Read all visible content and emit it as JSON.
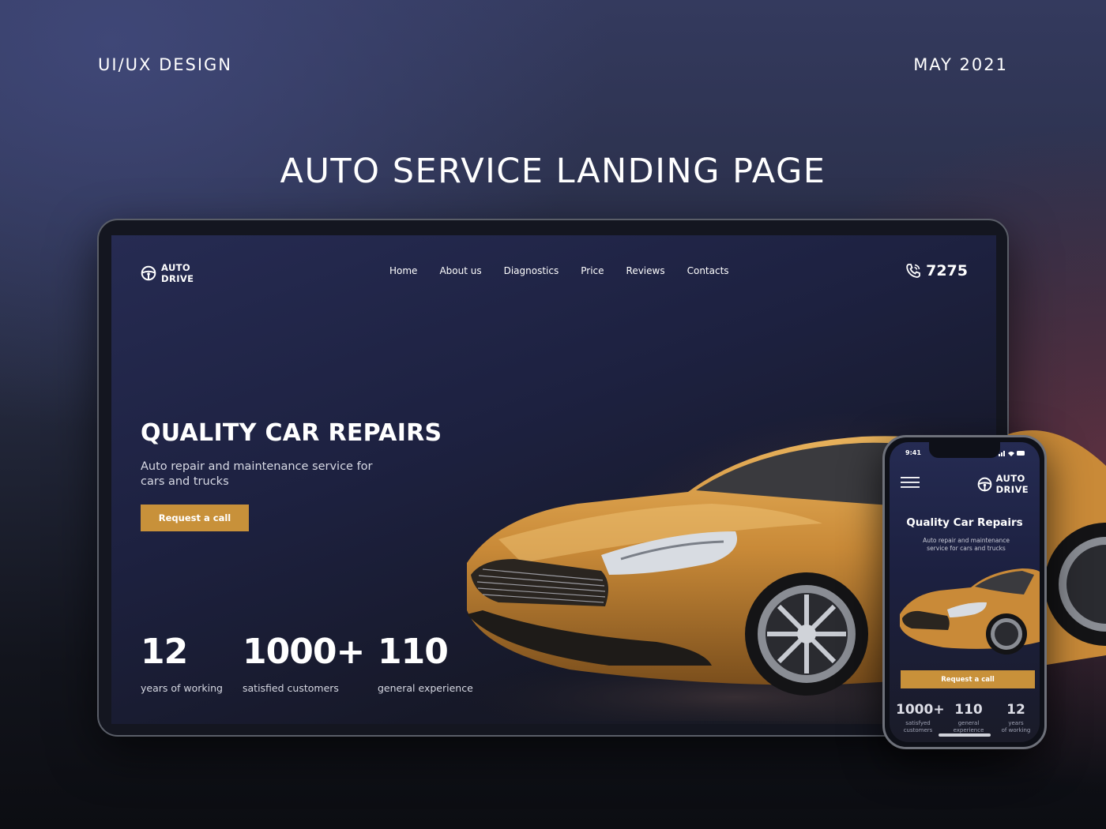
{
  "header": {
    "category": "UI/UX DESIGN",
    "date": "MAY 2021",
    "title": "AUTO SERVICE LANDING PAGE"
  },
  "site": {
    "logo": {
      "line1": "AUTO",
      "line2": "DRIVE",
      "icon": "steering-wheel-icon"
    },
    "nav": [
      "Home",
      "About us",
      "Diagnostics",
      "Price",
      "Reviews",
      "Contacts"
    ],
    "phone": "7275",
    "phone_icon": "phone-icon",
    "hero": {
      "title": "QUALITY CAR REPAIRS",
      "subtitle": "Auto repair and maintenance service for cars and trucks",
      "cta": "Request a call"
    },
    "stats": [
      {
        "value": "12",
        "label": "years of working"
      },
      {
        "value": "1000+",
        "label": "satisfied customers"
      },
      {
        "value": "110",
        "label": "general experience"
      }
    ]
  },
  "mobile": {
    "time": "9:41",
    "logo": {
      "line1": "AUTO",
      "line2": "DRIVE"
    },
    "title": "Quality Car Repairs",
    "subtitle": "Auto repair and maintenance service for cars and trucks",
    "cta": "Request a call",
    "stats": [
      {
        "value": "1000+",
        "label1": "satisfyed",
        "label2": "customers"
      },
      {
        "value": "110",
        "label1": "general",
        "label2": "experience"
      },
      {
        "value": "12",
        "label1": "years",
        "label2": "of working"
      }
    ]
  },
  "colors": {
    "accent": "#c8913a",
    "car": "#c98a38",
    "bg_dark": "#1d2140"
  }
}
